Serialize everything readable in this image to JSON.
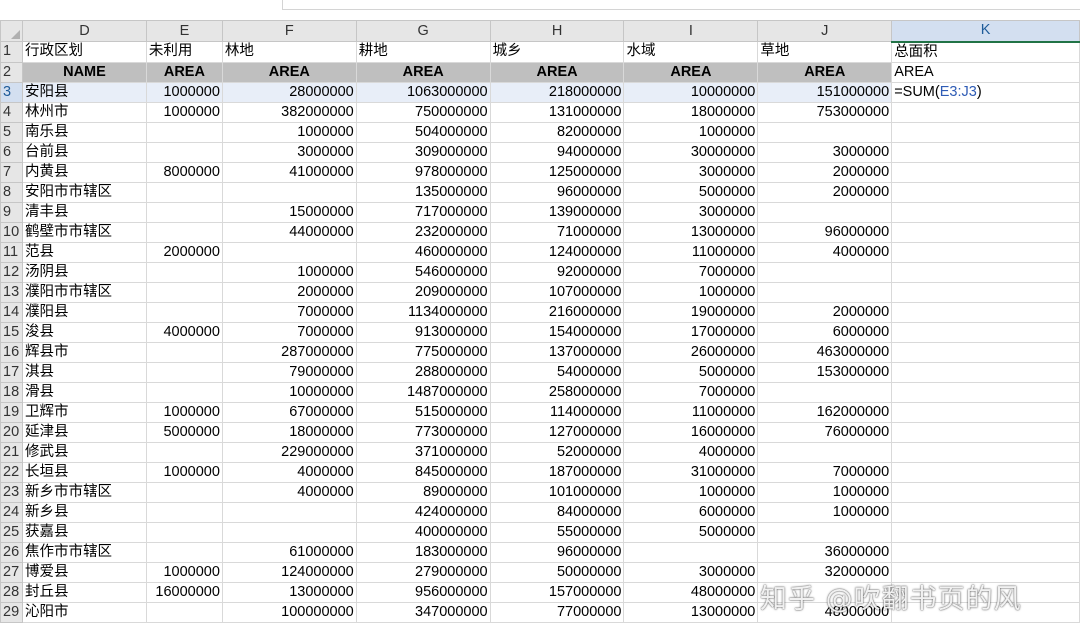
{
  "columns": [
    "D",
    "E",
    "F",
    "G",
    "H",
    "I",
    "J",
    "K"
  ],
  "active_cell": {
    "formula_prefix": "=SUM(",
    "formula_ref": "E3:J3",
    "formula_suffix": ")"
  },
  "header_row1": [
    "行政区划",
    "未利用",
    "林地",
    "耕地",
    "城乡",
    "水域",
    "草地",
    "总面积"
  ],
  "header_row2": [
    "NAME",
    "AREA",
    "AREA",
    "AREA",
    "AREA",
    "AREA",
    "AREA",
    "AREA"
  ],
  "rows": [
    {
      "n": "3",
      "c": [
        "安阳县",
        "1000000",
        "28000000",
        "1063000000",
        "218000000",
        "10000000",
        "151000000"
      ]
    },
    {
      "n": "4",
      "c": [
        "林州市",
        "1000000",
        "382000000",
        "750000000",
        "131000000",
        "18000000",
        "753000000"
      ]
    },
    {
      "n": "5",
      "c": [
        "南乐县",
        "",
        "1000000",
        "504000000",
        "82000000",
        "1000000",
        ""
      ]
    },
    {
      "n": "6",
      "c": [
        "台前县",
        "",
        "3000000",
        "309000000",
        "94000000",
        "30000000",
        "3000000"
      ]
    },
    {
      "n": "7",
      "c": [
        "内黄县",
        "8000000",
        "41000000",
        "978000000",
        "125000000",
        "3000000",
        "2000000"
      ]
    },
    {
      "n": "8",
      "c": [
        "安阳市市辖区",
        "",
        "",
        "135000000",
        "96000000",
        "5000000",
        "2000000"
      ]
    },
    {
      "n": "9",
      "c": [
        "清丰县",
        "",
        "15000000",
        "717000000",
        "139000000",
        "3000000",
        ""
      ]
    },
    {
      "n": "10",
      "c": [
        "鹤壁市市辖区",
        "",
        "44000000",
        "232000000",
        "71000000",
        "13000000",
        "96000000"
      ]
    },
    {
      "n": "11",
      "c": [
        "范县",
        "2000000",
        "",
        "460000000",
        "124000000",
        "11000000",
        "4000000"
      ]
    },
    {
      "n": "12",
      "c": [
        "汤阴县",
        "",
        "1000000",
        "546000000",
        "92000000",
        "7000000",
        ""
      ]
    },
    {
      "n": "13",
      "c": [
        "濮阳市市辖区",
        "",
        "2000000",
        "209000000",
        "107000000",
        "1000000",
        ""
      ]
    },
    {
      "n": "14",
      "c": [
        "濮阳县",
        "",
        "7000000",
        "1134000000",
        "216000000",
        "19000000",
        "2000000"
      ]
    },
    {
      "n": "15",
      "c": [
        "浚县",
        "4000000",
        "7000000",
        "913000000",
        "154000000",
        "17000000",
        "6000000"
      ]
    },
    {
      "n": "16",
      "c": [
        "辉县市",
        "",
        "287000000",
        "775000000",
        "137000000",
        "26000000",
        "463000000"
      ]
    },
    {
      "n": "17",
      "c": [
        "淇县",
        "",
        "79000000",
        "288000000",
        "54000000",
        "5000000",
        "153000000"
      ]
    },
    {
      "n": "18",
      "c": [
        "滑县",
        "",
        "10000000",
        "1487000000",
        "258000000",
        "7000000",
        ""
      ]
    },
    {
      "n": "19",
      "c": [
        "卫辉市",
        "1000000",
        "67000000",
        "515000000",
        "114000000",
        "11000000",
        "162000000"
      ]
    },
    {
      "n": "20",
      "c": [
        "延津县",
        "5000000",
        "18000000",
        "773000000",
        "127000000",
        "16000000",
        "76000000"
      ]
    },
    {
      "n": "21",
      "c": [
        "修武县",
        "",
        "229000000",
        "371000000",
        "52000000",
        "4000000",
        ""
      ]
    },
    {
      "n": "22",
      "c": [
        "长垣县",
        "1000000",
        "4000000",
        "845000000",
        "187000000",
        "31000000",
        "7000000"
      ]
    },
    {
      "n": "23",
      "c": [
        "新乡市市辖区",
        "",
        "4000000",
        "89000000",
        "101000000",
        "1000000",
        "1000000"
      ]
    },
    {
      "n": "24",
      "c": [
        "新乡县",
        "",
        "",
        "424000000",
        "84000000",
        "6000000",
        "1000000"
      ]
    },
    {
      "n": "25",
      "c": [
        "获嘉县",
        "",
        "",
        "400000000",
        "55000000",
        "5000000",
        ""
      ]
    },
    {
      "n": "26",
      "c": [
        "焦作市市辖区",
        "",
        "61000000",
        "183000000",
        "96000000",
        "",
        "36000000"
      ]
    },
    {
      "n": "27",
      "c": [
        "博爱县",
        "1000000",
        "124000000",
        "279000000",
        "50000000",
        "3000000",
        "32000000"
      ]
    },
    {
      "n": "28",
      "c": [
        "封丘县",
        "16000000",
        "13000000",
        "956000000",
        "157000000",
        "48000000",
        ""
      ]
    },
    {
      "n": "29",
      "c": [
        "沁阳市",
        "",
        "100000000",
        "347000000",
        "77000000",
        "13000000",
        "48000000"
      ]
    }
  ],
  "watermark": "知乎 @吹翻书页的风",
  "colors": {
    "accent_green": "#217346",
    "field_header_bg": "#bfbfbf",
    "selected_row_bg": "#e8eef8",
    "formula_ref": "#2f5cb5"
  }
}
